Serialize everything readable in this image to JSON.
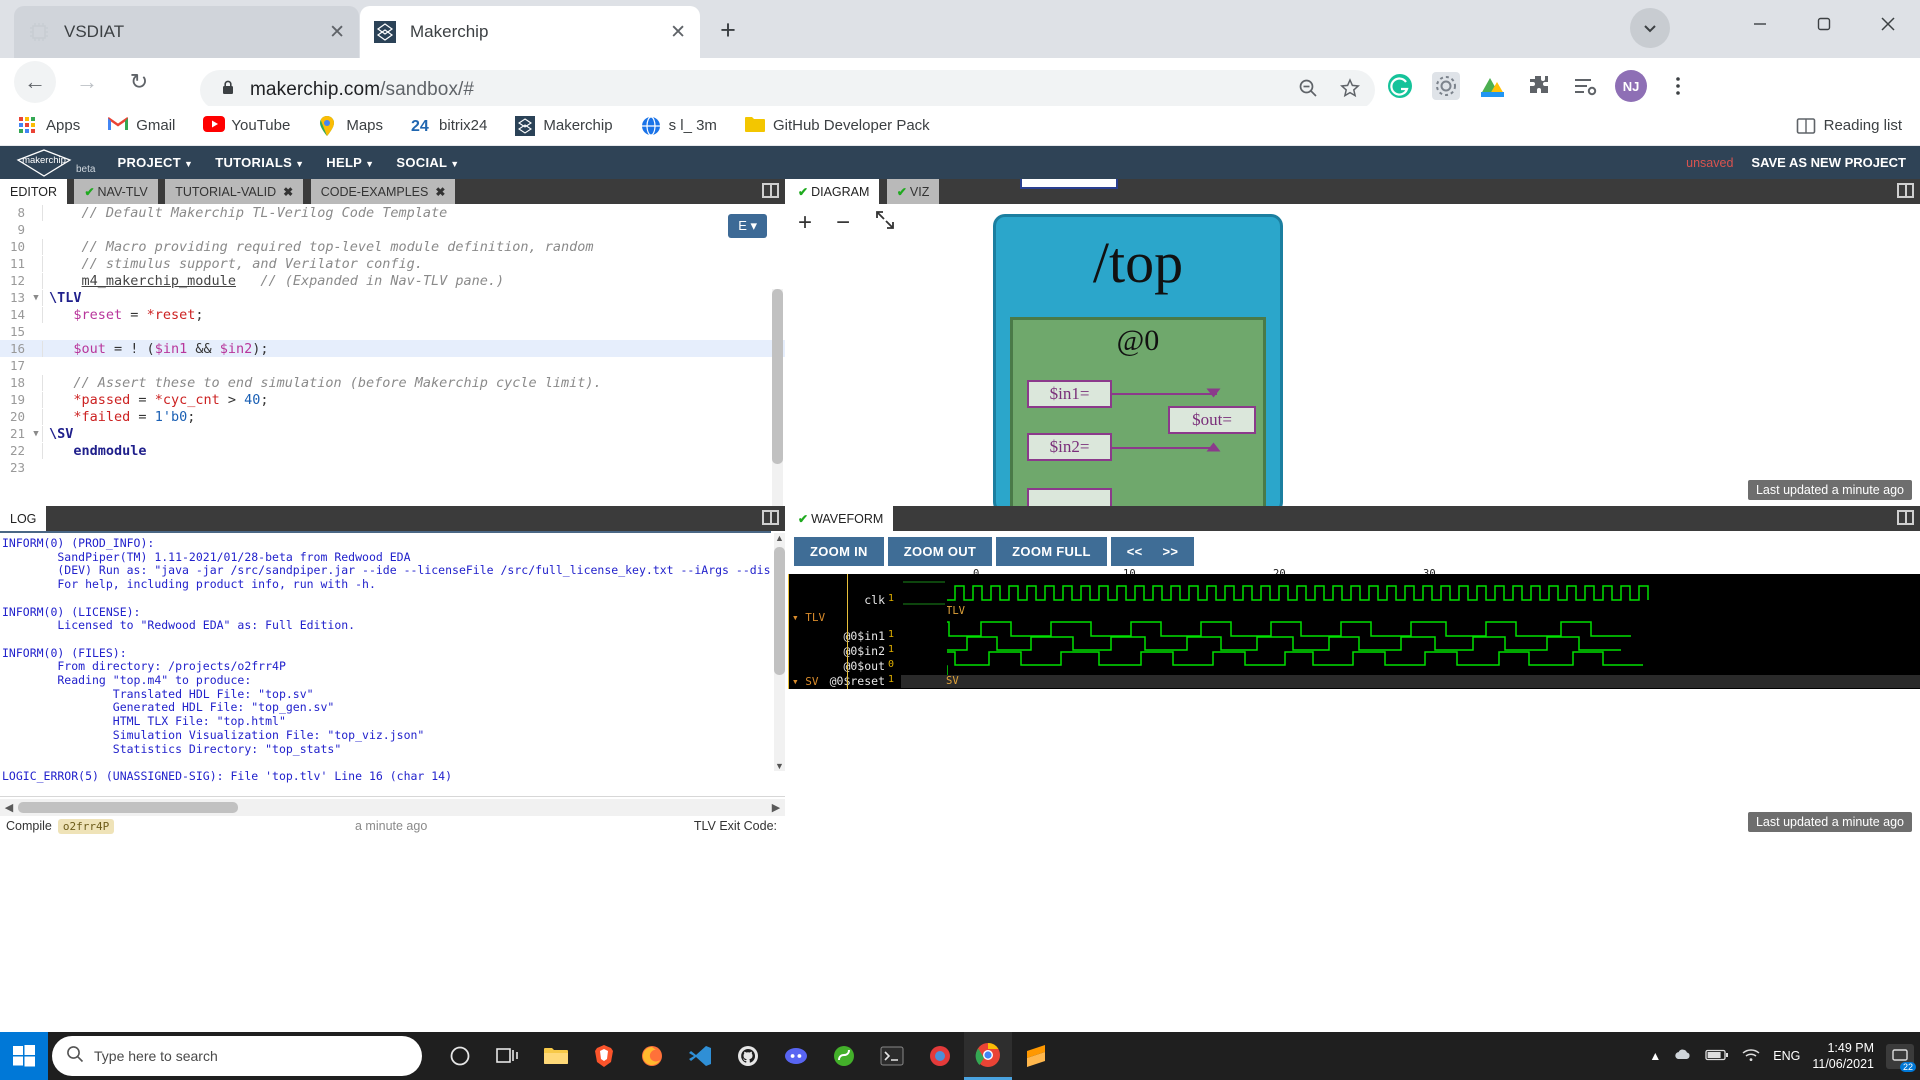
{
  "browser": {
    "tabs": [
      {
        "title": "VSDIAT",
        "favicon": "chip-icon",
        "active": false
      },
      {
        "title": "Makerchip",
        "favicon": "makerchip-icon",
        "active": true
      }
    ],
    "new_tab_label": "+",
    "nav": {
      "back": "back-arrow",
      "forward": "forward-arrow",
      "reload": "reload-icon",
      "url_secure": "makerchip.com",
      "url_path": "/sandbox/#",
      "url_full": "makerchip.com/sandbox/#"
    },
    "bookmarks": [
      {
        "label": "Apps",
        "icon": "apps-grid-icon"
      },
      {
        "label": "Gmail",
        "icon": "gmail-icon"
      },
      {
        "label": "YouTube",
        "icon": "youtube-icon"
      },
      {
        "label": "Maps",
        "icon": "maps-icon"
      },
      {
        "label": "bitrix24",
        "icon": "bitrix24-icon"
      },
      {
        "label": "Makerchip",
        "icon": "makerchip-icon"
      },
      {
        "label": "s l_ 3m",
        "icon": "globe-icon"
      },
      {
        "label": "GitHub Developer Pack",
        "icon": "folder-icon"
      }
    ],
    "reading_list": "Reading list",
    "profile_initials": "NJ",
    "window_controls": {
      "minimize": "—",
      "maximize": "❑",
      "close": "✕"
    }
  },
  "makerchip": {
    "brand": "makerchip",
    "brand_sub": "beta",
    "menus": [
      "PROJECT",
      "TUTORIALS",
      "HELP",
      "SOCIAL"
    ],
    "unsaved_label": "unsaved",
    "save_label": "SAVE AS NEW PROJECT",
    "editor": {
      "tabs": [
        {
          "label": "EDITOR",
          "active": true,
          "check": false,
          "closable": false
        },
        {
          "label": "NAV-TLV",
          "active": false,
          "check": true,
          "closable": false
        },
        {
          "label": "TUTORIAL-VALID",
          "active": false,
          "check": false,
          "closable": true
        },
        {
          "label": "CODE-EXAMPLES",
          "active": false,
          "check": false,
          "closable": true
        }
      ],
      "menu_badge": "E",
      "lines": [
        {
          "num": "8",
          "fold": false,
          "hl": false,
          "tokens": [
            {
              "t": "    // Default Makerchip TL-Verilog Code Template",
              "c": "c-cmt"
            }
          ]
        },
        {
          "num": "9",
          "fold": false,
          "hl": false,
          "tokens": []
        },
        {
          "num": "10",
          "fold": false,
          "hl": false,
          "tokens": [
            {
              "t": "    // Macro providing required top-level module definition, random",
              "c": "c-cmt"
            }
          ]
        },
        {
          "num": "11",
          "fold": false,
          "hl": false,
          "tokens": [
            {
              "t": "    // stimulus support, and Verilator config.",
              "c": "c-cmt"
            }
          ]
        },
        {
          "num": "12",
          "fold": false,
          "hl": false,
          "tokens": [
            {
              "t": "    ",
              "c": "c-plain"
            },
            {
              "t": "m4_makerchip_module",
              "c": "c-macro"
            },
            {
              "t": "   ",
              "c": "c-plain"
            },
            {
              "t": "// (Expanded in Nav-TLV pane.)",
              "c": "c-cmt"
            }
          ]
        },
        {
          "num": "13",
          "fold": true,
          "hl": false,
          "tokens": [
            {
              "t": "\\TLV",
              "c": "c-kw"
            }
          ]
        },
        {
          "num": "14",
          "fold": false,
          "hl": false,
          "tokens": [
            {
              "t": "   ",
              "c": "c-plain"
            },
            {
              "t": "$reset",
              "c": "c-sig"
            },
            {
              "t": " = ",
              "c": "c-plain"
            },
            {
              "t": "*reset",
              "c": "c-star"
            },
            {
              "t": ";",
              "c": "c-plain"
            }
          ]
        },
        {
          "num": "15",
          "fold": false,
          "hl": false,
          "tokens": []
        },
        {
          "num": "16",
          "fold": false,
          "hl": true,
          "tokens": [
            {
              "t": "   ",
              "c": "c-plain"
            },
            {
              "t": "$out",
              "c": "c-sig"
            },
            {
              "t": " = ! (",
              "c": "c-plain"
            },
            {
              "t": "$in1",
              "c": "c-sig"
            },
            {
              "t": " && ",
              "c": "c-plain"
            },
            {
              "t": "$in2",
              "c": "c-sig"
            },
            {
              "t": ");",
              "c": "c-plain"
            }
          ]
        },
        {
          "num": "17",
          "fold": false,
          "hl": false,
          "tokens": []
        },
        {
          "num": "18",
          "fold": false,
          "hl": false,
          "tokens": [
            {
              "t": "   // Assert these to end simulation (before Makerchip cycle limit).",
              "c": "c-cmt"
            }
          ]
        },
        {
          "num": "19",
          "fold": false,
          "hl": false,
          "tokens": [
            {
              "t": "   ",
              "c": "c-plain"
            },
            {
              "t": "*passed",
              "c": "c-star"
            },
            {
              "t": " = ",
              "c": "c-plain"
            },
            {
              "t": "*cyc_cnt",
              "c": "c-star"
            },
            {
              "t": " > ",
              "c": "c-plain"
            },
            {
              "t": "40",
              "c": "c-num"
            },
            {
              "t": ";",
              "c": "c-plain"
            }
          ]
        },
        {
          "num": "20",
          "fold": false,
          "hl": false,
          "tokens": [
            {
              "t": "   ",
              "c": "c-plain"
            },
            {
              "t": "*failed",
              "c": "c-star"
            },
            {
              "t": " = ",
              "c": "c-plain"
            },
            {
              "t": "1'b0",
              "c": "c-num"
            },
            {
              "t": ";",
              "c": "c-plain"
            }
          ]
        },
        {
          "num": "21",
          "fold": true,
          "hl": false,
          "tokens": [
            {
              "t": "\\SV",
              "c": "c-kw"
            }
          ]
        },
        {
          "num": "22",
          "fold": false,
          "hl": false,
          "tokens": [
            {
              "t": "   endmodule",
              "c": "c-kw"
            }
          ]
        },
        {
          "num": "23",
          "fold": false,
          "hl": false,
          "tokens": []
        }
      ]
    },
    "log": {
      "tab_label": "LOG",
      "text": "INFORM(0) (PROD_INFO):\n        SandPiper(TM) 1.11-2021/01/28-beta from Redwood EDA\n        (DEV) Run as: \"java -jar /src/sandpiper.jar --ide --licenseFile /src/full_license_key.txt --iArgs --distroRef=NO_DISTRO --debugSigs -\n        For help, including product info, run with -h.\n\nINFORM(0) (LICENSE):\n        Licensed to \"Redwood EDA\" as: Full Edition.\n\nINFORM(0) (FILES):\n        From directory: /projects/o2frr4P\n        Reading \"top.m4\" to produce:\n                Translated HDL File: \"top.sv\"\n                Generated HDL File: \"top_gen.sv\"\n                HTML TLX File: \"top.html\"\n                Simulation Visualization File: \"top_viz.json\"\n                Statistics Directory: \"top_stats\"\n\nLOGIC_ERROR(5) (UNASSIGNED-SIG): File 'top.tlv' Line 16 (char 14)",
      "status": {
        "compile_label": "Compile",
        "project_id": "o2frr4P",
        "time_label": "a minute ago",
        "exit_label": "TLV Exit Code:"
      }
    },
    "diagram": {
      "tabs": [
        {
          "label": "DIAGRAM",
          "active": true,
          "check": true
        },
        {
          "label": "VIZ",
          "active": false,
          "check": true
        }
      ],
      "tools": {
        "zoom_in": "+",
        "zoom_out": "−",
        "fit": "expand-icon"
      },
      "chip_label": "/top",
      "stage_label": "@0",
      "signals": [
        "$in1=",
        "$in2=",
        "$out="
      ],
      "out_label": "$out=",
      "stale_tooltip": "Last updated a minute ago"
    },
    "waveform": {
      "tab_label": "WAVEFORM",
      "buttons": [
        "ZOOM IN",
        "ZOOM OUT",
        "ZOOM FULL"
      ],
      "nav_buttons": [
        "<<",
        ">>"
      ],
      "time_ticks": [
        "0",
        "10",
        "20",
        "30"
      ],
      "signals": [
        {
          "name": "clk",
          "value": "1",
          "scope": ""
        },
        {
          "name": "TLV",
          "value": "",
          "scope": "TLV"
        },
        {
          "name": "@0$in1",
          "value": "1",
          "scope": ""
        },
        {
          "name": "@0$in2",
          "value": "1",
          "scope": ""
        },
        {
          "name": "@0$out",
          "value": "0",
          "scope": ""
        },
        {
          "name": "@0$reset",
          "value": "1",
          "scope": ""
        },
        {
          "name": "SV",
          "value": "",
          "scope": "SV"
        }
      ],
      "stale_tooltip": "Last updated a minute ago"
    }
  },
  "taskbar": {
    "search_placeholder": "Type here to search",
    "icons": [
      "cortana-icon",
      "task-view-icon",
      "file-explorer-icon",
      "brave-icon",
      "firefox-icon",
      "vscode-icon",
      "github-icon",
      "discord-icon",
      "anaconda-icon",
      "terminal-icon",
      "app-icon",
      "chrome-icon",
      "sublime-icon"
    ],
    "tray": {
      "language": "ENG",
      "time": "1:49 PM",
      "date": "11/06/2021",
      "notifications": "22"
    }
  }
}
